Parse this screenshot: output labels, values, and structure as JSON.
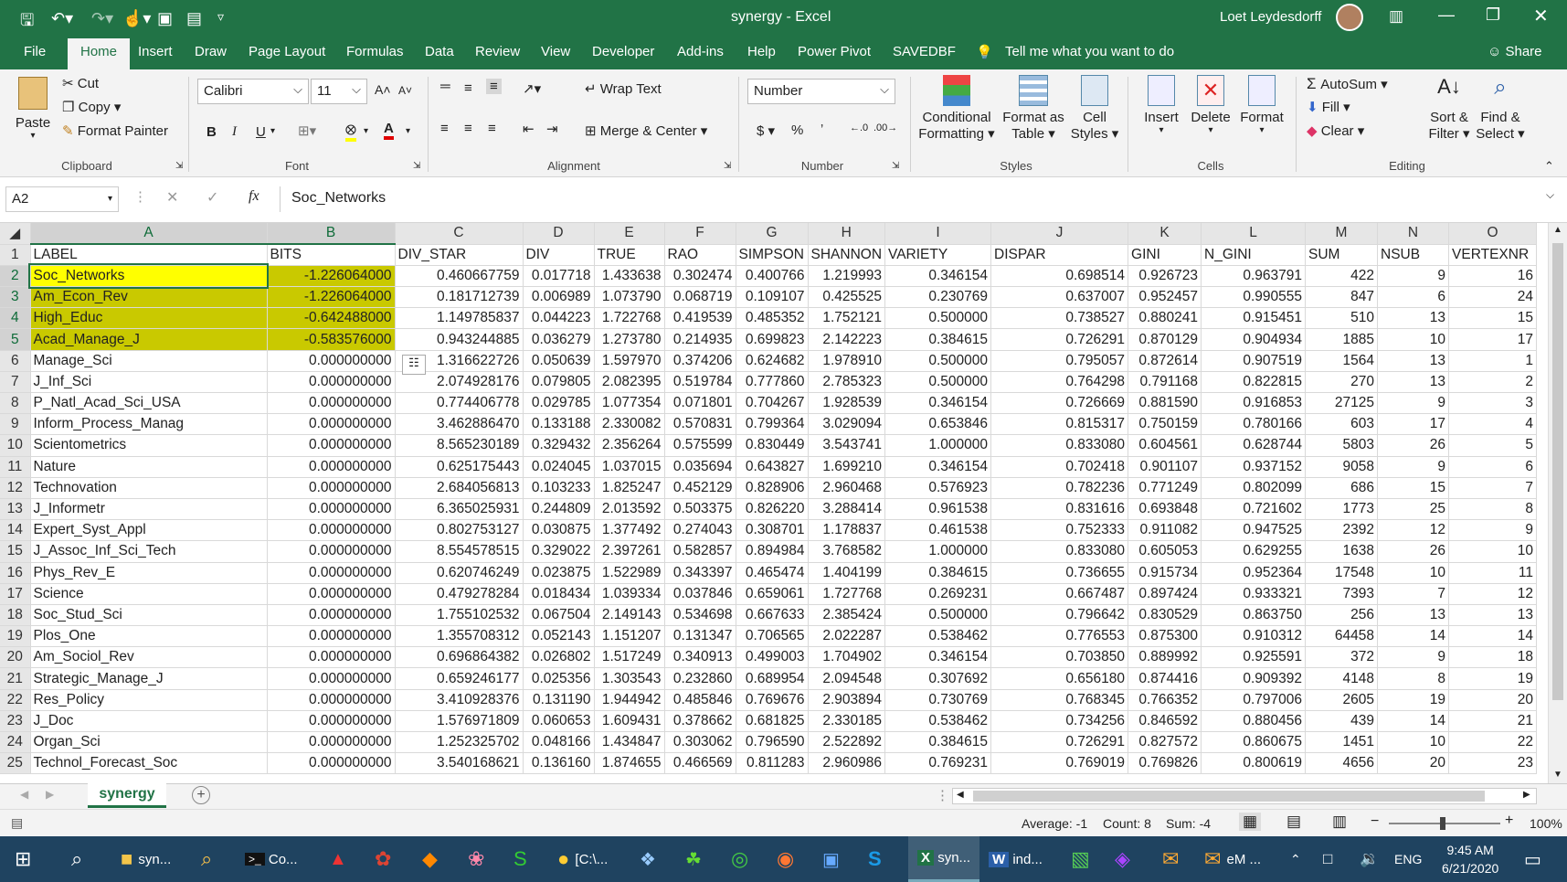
{
  "window": {
    "title": "synergy  -  Excel",
    "user": "Loet Leydesdorff"
  },
  "tabs": [
    "File",
    "Home",
    "Insert",
    "Draw",
    "Page Layout",
    "Formulas",
    "Data",
    "Review",
    "View",
    "Developer",
    "Add-ins",
    "Help",
    "Power Pivot",
    "SAVEDBF"
  ],
  "tell_me": "Tell me what you want to do",
  "share": "Share",
  "ribbon": {
    "clipboard": {
      "group": "Clipboard",
      "paste": "Paste",
      "cut": "Cut",
      "copy": "Copy",
      "format_painter": "Format Painter"
    },
    "font": {
      "group": "Font",
      "name": "Calibri",
      "size": "11"
    },
    "alignment": {
      "group": "Alignment",
      "wrap": "Wrap Text",
      "merge": "Merge & Center"
    },
    "number": {
      "group": "Number",
      "format": "Number"
    },
    "styles": {
      "group": "Styles",
      "cond1": "Conditional",
      "cond2": "Formatting",
      "fmt1": "Format as",
      "fmt2": "Table",
      "cell1": "Cell",
      "cell2": "Styles"
    },
    "cells": {
      "group": "Cells",
      "insert": "Insert",
      "delete": "Delete",
      "format": "Format"
    },
    "editing": {
      "group": "Editing",
      "autosum": "AutoSum",
      "fill": "Fill",
      "clear": "Clear",
      "sort1": "Sort &",
      "sort2": "Filter",
      "find1": "Find &",
      "find2": "Select"
    }
  },
  "formula_bar": {
    "name_box": "A2",
    "formula": "Soc_Networks"
  },
  "columns": [
    "A",
    "B",
    "C",
    "D",
    "E",
    "F",
    "G",
    "H",
    "I",
    "J",
    "K",
    "L",
    "M",
    "N",
    "O"
  ],
  "rows": [
    [
      "1",
      "LABEL",
      "BITS",
      "DIV_STAR",
      "DIV",
      "TRUE",
      "RAO",
      "SIMPSON",
      "SHANNON",
      "VARIETY",
      "DISPAR",
      "GINI",
      "N_GINI",
      "SUM",
      "NSUB",
      "VERTEXNR"
    ],
    [
      "2",
      "Soc_Networks",
      "-1.226064000",
      "0.460667759",
      "0.017718",
      "1.433638",
      "0.302474",
      "0.400766",
      "1.219993",
      "0.346154",
      "0.698514",
      "0.926723",
      "0.963791",
      "422",
      "9",
      "16"
    ],
    [
      "3",
      "Am_Econ_Rev",
      "-1.226064000",
      "0.181712739",
      "0.006989",
      "1.073790",
      "0.068719",
      "0.109107",
      "0.425525",
      "0.230769",
      "0.637007",
      "0.952457",
      "0.990555",
      "847",
      "6",
      "24"
    ],
    [
      "4",
      "High_Educ",
      "-0.642488000",
      "1.149785837",
      "0.044223",
      "1.722768",
      "0.419539",
      "0.485352",
      "1.752121",
      "0.500000",
      "0.738527",
      "0.880241",
      "0.915451",
      "510",
      "13",
      "15"
    ],
    [
      "5",
      "Acad_Manage_J",
      "-0.583576000",
      "0.943244885",
      "0.036279",
      "1.273780",
      "0.214935",
      "0.699823",
      "2.142223",
      "0.384615",
      "0.726291",
      "0.870129",
      "0.904934",
      "1885",
      "10",
      "17"
    ],
    [
      "6",
      "Manage_Sci",
      "0.000000000",
      "1.316622726",
      "0.050639",
      "1.597970",
      "0.374206",
      "0.624682",
      "1.978910",
      "0.500000",
      "0.795057",
      "0.872614",
      "0.907519",
      "1564",
      "13",
      "1"
    ],
    [
      "7",
      "J_Inf_Sci",
      "0.000000000",
      "2.074928176",
      "0.079805",
      "2.082395",
      "0.519784",
      "0.777860",
      "2.785323",
      "0.500000",
      "0.764298",
      "0.791168",
      "0.822815",
      "270",
      "13",
      "2"
    ],
    [
      "8",
      "P_Natl_Acad_Sci_USA",
      "0.000000000",
      "0.774406778",
      "0.029785",
      "1.077354",
      "0.071801",
      "0.704267",
      "1.928539",
      "0.346154",
      "0.726669",
      "0.881590",
      "0.916853",
      "27125",
      "9",
      "3"
    ],
    [
      "9",
      "Inform_Process_Manag",
      "0.000000000",
      "3.462886470",
      "0.133188",
      "2.330082",
      "0.570831",
      "0.799364",
      "3.029094",
      "0.653846",
      "0.815317",
      "0.750159",
      "0.780166",
      "603",
      "17",
      "4"
    ],
    [
      "10",
      "Scientometrics",
      "0.000000000",
      "8.565230189",
      "0.329432",
      "2.356264",
      "0.575599",
      "0.830449",
      "3.543741",
      "1.000000",
      "0.833080",
      "0.604561",
      "0.628744",
      "5803",
      "26",
      "5"
    ],
    [
      "11",
      "Nature",
      "0.000000000",
      "0.625175443",
      "0.024045",
      "1.037015",
      "0.035694",
      "0.643827",
      "1.699210",
      "0.346154",
      "0.702418",
      "0.901107",
      "0.937152",
      "9058",
      "9",
      "6"
    ],
    [
      "12",
      "Technovation",
      "0.000000000",
      "2.684056813",
      "0.103233",
      "1.825247",
      "0.452129",
      "0.828906",
      "2.960468",
      "0.576923",
      "0.782236",
      "0.771249",
      "0.802099",
      "686",
      "15",
      "7"
    ],
    [
      "13",
      "J_Informetr",
      "0.000000000",
      "6.365025931",
      "0.244809",
      "2.013592",
      "0.503375",
      "0.826220",
      "3.288414",
      "0.961538",
      "0.831616",
      "0.693848",
      "0.721602",
      "1773",
      "25",
      "8"
    ],
    [
      "14",
      "Expert_Syst_Appl",
      "0.000000000",
      "0.802753127",
      "0.030875",
      "1.377492",
      "0.274043",
      "0.308701",
      "1.178837",
      "0.461538",
      "0.752333",
      "0.911082",
      "0.947525",
      "2392",
      "12",
      "9"
    ],
    [
      "15",
      "J_Assoc_Inf_Sci_Tech",
      "0.000000000",
      "8.554578515",
      "0.329022",
      "2.397261",
      "0.582857",
      "0.894984",
      "3.768582",
      "1.000000",
      "0.833080",
      "0.605053",
      "0.629255",
      "1638",
      "26",
      "10"
    ],
    [
      "16",
      "Phys_Rev_E",
      "0.000000000",
      "0.620746249",
      "0.023875",
      "1.522989",
      "0.343397",
      "0.465474",
      "1.404199",
      "0.384615",
      "0.736655",
      "0.915734",
      "0.952364",
      "17548",
      "10",
      "11"
    ],
    [
      "17",
      "Science",
      "0.000000000",
      "0.479278284",
      "0.018434",
      "1.039334",
      "0.037846",
      "0.659061",
      "1.727768",
      "0.269231",
      "0.667487",
      "0.897424",
      "0.933321",
      "7393",
      "7",
      "12"
    ],
    [
      "18",
      "Soc_Stud_Sci",
      "0.000000000",
      "1.755102532",
      "0.067504",
      "2.149143",
      "0.534698",
      "0.667633",
      "2.385424",
      "0.500000",
      "0.796642",
      "0.830529",
      "0.863750",
      "256",
      "13",
      "13"
    ],
    [
      "19",
      "Plos_One",
      "0.000000000",
      "1.355708312",
      "0.052143",
      "1.151207",
      "0.131347",
      "0.706565",
      "2.022287",
      "0.538462",
      "0.776553",
      "0.875300",
      "0.910312",
      "64458",
      "14",
      "14"
    ],
    [
      "20",
      "Am_Sociol_Rev",
      "0.000000000",
      "0.696864382",
      "0.026802",
      "1.517249",
      "0.340913",
      "0.499003",
      "1.704902",
      "0.346154",
      "0.703850",
      "0.889992",
      "0.925591",
      "372",
      "9",
      "18"
    ],
    [
      "21",
      "Strategic_Manage_J",
      "0.000000000",
      "0.659246177",
      "0.025356",
      "1.303543",
      "0.232860",
      "0.689954",
      "2.094548",
      "0.307692",
      "0.656180",
      "0.874416",
      "0.909392",
      "4148",
      "8",
      "19"
    ],
    [
      "22",
      "Res_Policy",
      "0.000000000",
      "3.410928376",
      "0.131190",
      "1.944942",
      "0.485846",
      "0.769676",
      "2.903894",
      "0.730769",
      "0.768345",
      "0.766352",
      "0.797006",
      "2605",
      "19",
      "20"
    ],
    [
      "23",
      "J_Doc",
      "0.000000000",
      "1.576971809",
      "0.060653",
      "1.609431",
      "0.378662",
      "0.681825",
      "2.330185",
      "0.538462",
      "0.734256",
      "0.846592",
      "0.880456",
      "439",
      "14",
      "21"
    ],
    [
      "24",
      "Organ_Sci",
      "0.000000000",
      "1.252325702",
      "0.048166",
      "1.434847",
      "0.303062",
      "0.796590",
      "2.522892",
      "0.384615",
      "0.726291",
      "0.827572",
      "0.860675",
      "1451",
      "10",
      "22"
    ],
    [
      "25",
      "Technol_Forecast_Soc",
      "0.000000000",
      "3.540168621",
      "0.136160",
      "1.874655",
      "0.466569",
      "0.811283",
      "2.960986",
      "0.769231",
      "0.769019",
      "0.769826",
      "0.800619",
      "4656",
      "20",
      "23"
    ]
  ],
  "sheet_tab": "synergy",
  "status": {
    "average": "Average: -1",
    "count": "Count: 8",
    "sum": "Sum: -4",
    "zoom": "100%"
  },
  "taskbar": {
    "items": [
      "syn...",
      "Co...",
      "[C:\\...",
      "syn...",
      "ind...",
      "eM ..."
    ],
    "lang": "ENG",
    "time": "9:45 AM",
    "date": "6/21/2020"
  }
}
